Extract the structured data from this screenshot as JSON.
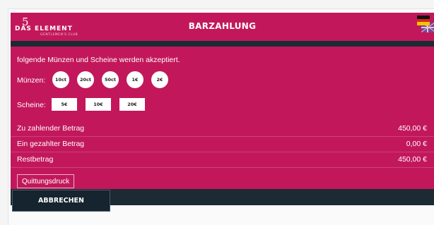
{
  "header": {
    "title": "BARZAHLUNG",
    "logo": {
      "five": "5",
      "main": "DAS ELEMENT",
      "sub": "GENTLEMEN'S CLUB"
    },
    "flags": [
      "de-flag",
      "uk-flag"
    ]
  },
  "content": {
    "intro": "folgende Münzen und Scheine werden akzeptiert.",
    "coins_label": "Münzen:",
    "coins": [
      "10ct",
      "20ct",
      "50ct",
      "1€",
      "2€"
    ],
    "notes_label": "Scheine:",
    "notes": [
      "5€",
      "10€",
      "20€"
    ],
    "summary": [
      {
        "label": "Zu zahlender Betrag",
        "value": "450,00 €"
      },
      {
        "label": "Ein gezahlter Betrag",
        "value": "0,00 €"
      },
      {
        "label": "Restbetrag",
        "value": "450,00 €"
      }
    ],
    "print_button": "Quittungsdruck"
  },
  "footer": {
    "cancel_button": "ABBRECHEN"
  },
  "colors": {
    "brand": "#c2185b",
    "dark": "#1c2a33"
  }
}
